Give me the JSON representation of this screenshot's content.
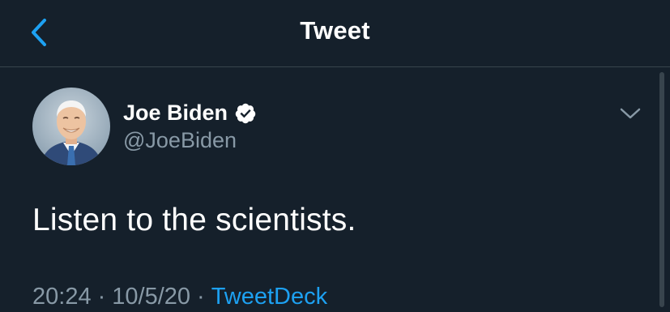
{
  "header": {
    "title": "Tweet",
    "back_icon": "chevron-left-icon"
  },
  "tweet": {
    "author": {
      "display_name": "Joe Biden",
      "handle": "@JoeBiden",
      "verified": true
    },
    "text": "Listen to the scientists.",
    "time": "20:24",
    "date": "10/5/20",
    "separator": "·",
    "source": "TweetDeck",
    "menu_icon": "chevron-down-icon"
  },
  "colors": {
    "background": "#15202b",
    "divider": "#38444d",
    "accent": "#1da1f2",
    "secondary_text": "#8899a6",
    "primary_text": "#ffffff"
  }
}
